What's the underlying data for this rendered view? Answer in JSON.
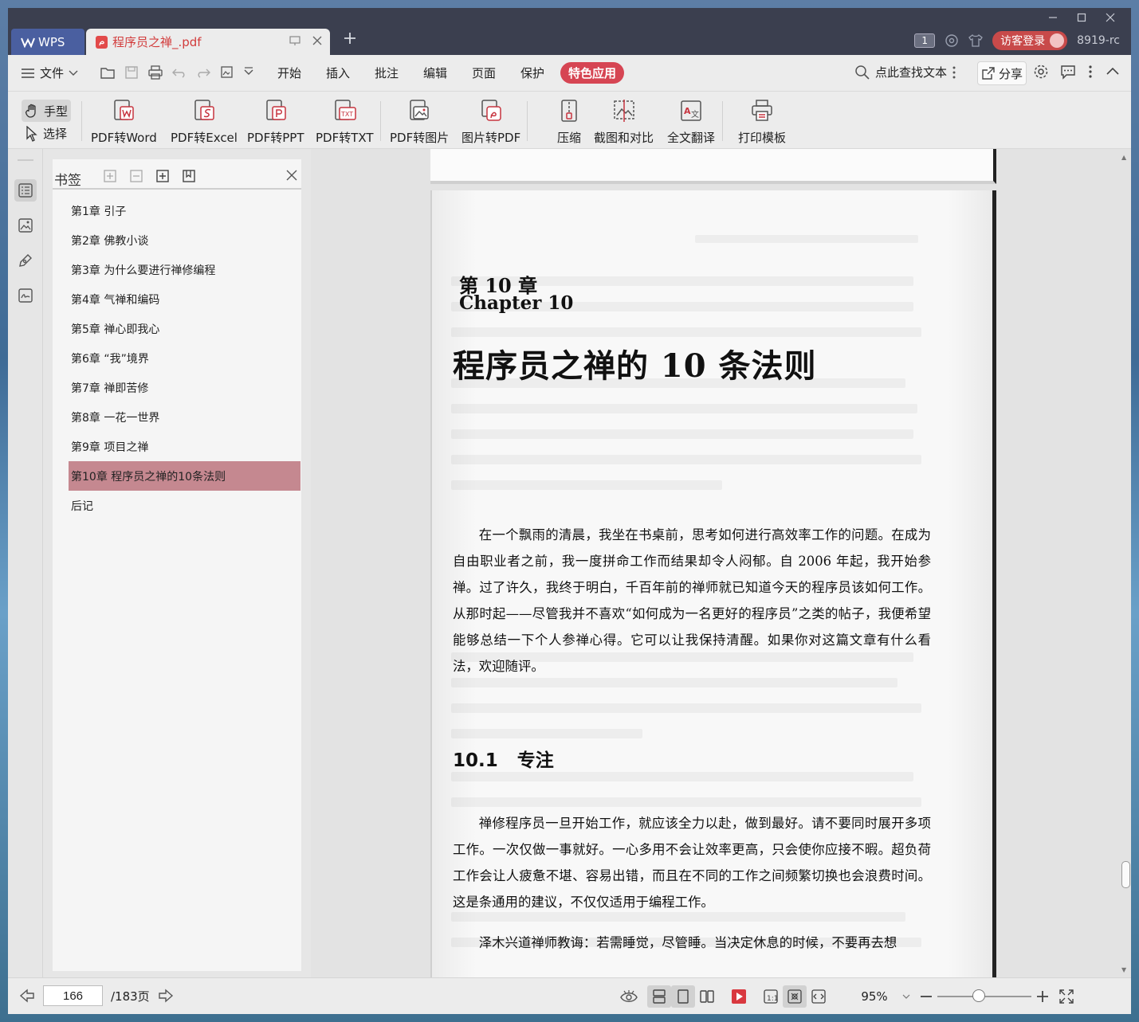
{
  "titlebar": {
    "app_tab": "WPS",
    "doc_tab": "程序员之禅_.pdf",
    "page_count_badge": "1",
    "login_label": "访客登录",
    "user_id": "8919-rc"
  },
  "menu": {
    "file": "文件",
    "items": [
      "开始",
      "插入",
      "批注",
      "编辑",
      "页面",
      "保护"
    ],
    "special": "特色应用",
    "search_placeholder": "点此查找文本",
    "share": "分享"
  },
  "toolbar": {
    "hand": "手型",
    "select": "选择",
    "buttons": [
      "PDF转Word",
      "PDF转Excel",
      "PDF转PPT",
      "PDF转TXT",
      "PDF转图片",
      "图片转PDF",
      "压缩",
      "截图和对比",
      "全文翻译",
      "打印模板"
    ]
  },
  "bookmarks": {
    "title": "书签",
    "items": [
      "第1章 引子",
      "第2章 佛教小谈",
      "第3章 为什么要进行禅修编程",
      "第4章 气禅和编码",
      "第5章 禅心即我心",
      "第6章 “我”境界",
      "第7章 禅即苦修",
      "第8章 一花一世界",
      "第9章 项目之禅",
      "第10章 程序员之禅的10条法则",
      "后记"
    ],
    "active_index": 9
  },
  "page": {
    "chapter_label": "第 10 章",
    "chapter_en": "Chapter 10",
    "chapter_title": "程序员之禅的 10 条法则",
    "paragraph1": "在一个飘雨的清晨，我坐在书桌前，思考如何进行高效率工作的问题。在成为自由职业者之前，我一度拼命工作而结果却令人闷郁。自 2006 年起，我开始参禅。过了许久，我终于明白，千百年前的禅师就已知道今天的程序员该如何工作。从那时起——尽管我并不喜欢“如何成为一名更好的程序员”之类的帖子，我便希望能够总结一下个人参禅心得。它可以让我保持清醒。如果你对这篇文章有什么看法，欢迎随评。",
    "section_num": "10.1",
    "section_title": "专注",
    "paragraph2": "禅修程序员一旦开始工作，就应该全力以赴，做到最好。请不要同时展开多项工作。一次仅做一事就好。一心多用不会让效率更高，只会使你应接不暇。超负荷工作会让人疲惫不堪、容易出错，而且在不同的工作之间频繁切换也会浪费时间。这是条通用的建议，不仅仅适用于编程工作。",
    "paragraph3": "泽木兴道禅师教诲：若需睡觉，尽管睡。当决定休息的时候，不要再去想"
  },
  "status": {
    "current_page": "166",
    "total_pages": "/183页",
    "zoom": "95%"
  }
}
